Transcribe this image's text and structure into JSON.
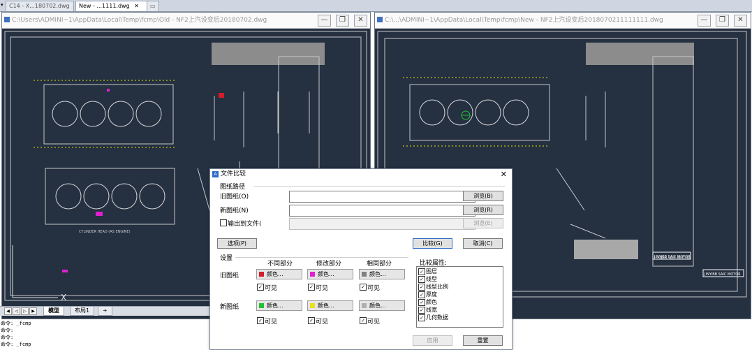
{
  "doc_tabs": [
    {
      "label": "C14 - X...180702.dwg"
    },
    {
      "label": "New - ...1111.dwg"
    }
  ],
  "windows": {
    "left": {
      "title": "C:\\Users\\ADMINI~1\\AppData\\Local\\Temp\\fcmp\\Old - NF2上汽设变后20180702.dwg"
    },
    "right": {
      "title": "C:\\...\\ADMINI~1\\AppData\\Local\\Temp\\fcmp\\New - NF2上汽设变后2018070211111111.dwg"
    },
    "minimize": "—",
    "restore": "❐",
    "close": "✕"
  },
  "drawing": {
    "label_left": "CYLINDER HEAD (AS ENGINE)",
    "title_block_right_1": "JINYIBB SAIC MOTOR",
    "title_block_right_2": "JINYIBB SAIC MOTOR",
    "title_block_small": "上汽集团 SAIC MOTOR"
  },
  "layout_tabs": [
    "模型",
    "布局1",
    "+"
  ],
  "command_lines": [
    "命令: _fcmp",
    "命令:",
    "命令:",
    "命令: _fcmp"
  ],
  "dialog": {
    "title": "文件比较",
    "close": "✕",
    "group_paths": "图纸路径",
    "old_label": "旧图纸(O)",
    "new_label": "新图纸(N)",
    "output_label": "输出到文件(",
    "old_value": "",
    "new_value": "",
    "output_value": "",
    "browse1": "浏览(B)",
    "browse2": "浏览(R)",
    "browse3": "浏览(E)",
    "options": "选项(P)",
    "compare": "比较(G)",
    "cancel": "取消(C)",
    "settings": "设置",
    "col_diff": "不同部分",
    "col_modified": "修改部分",
    "col_same": "相同部分",
    "row_old": "旧图纸",
    "row_new": "新图纸",
    "color_label": "颜色...",
    "visible_label": "可见",
    "colors": {
      "old_diff": "#d41c2a",
      "old_mod": "#e020d0",
      "old_same": "#808080",
      "new_diff": "#22c232",
      "new_mod": "#e8e020",
      "new_same": "#b0b0b0"
    },
    "props_title": "比较属性:",
    "props": [
      "图层",
      "线型",
      "线型比例",
      "厚度",
      "颜色",
      "线宽",
      "几何数据"
    ],
    "apply": "应用",
    "reset": "重置"
  }
}
